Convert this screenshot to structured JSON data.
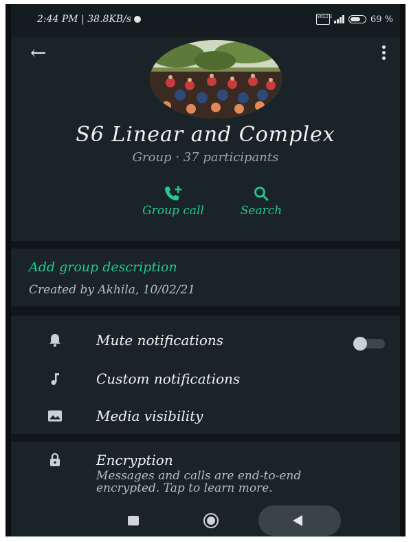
{
  "status_bar": {
    "time_speed": "2:44 PM | 38.8KB/s",
    "network_badge": "VoLTE",
    "battery": "69 %"
  },
  "group": {
    "name": "S6 Linear and Complex",
    "meta": "Group · 37 participants"
  },
  "actions": {
    "group_call": "Group call",
    "search": "Search"
  },
  "description": {
    "add_label": "Add group description",
    "created": "Created by Akhila, 10/02/21"
  },
  "settings": [
    {
      "label": "Mute notifications",
      "icon": "bell-icon"
    },
    {
      "label": "Custom notifications",
      "icon": "music-note-icon"
    },
    {
      "label": "Media visibility",
      "icon": "image-icon"
    }
  ],
  "mute_toggle": {
    "on": false
  },
  "encryption": {
    "title": "Encryption",
    "text": "Messages and calls are end-to-end encrypted. Tap to learn more."
  },
  "colors": {
    "accent": "#20c997",
    "background": "#1a2328"
  }
}
